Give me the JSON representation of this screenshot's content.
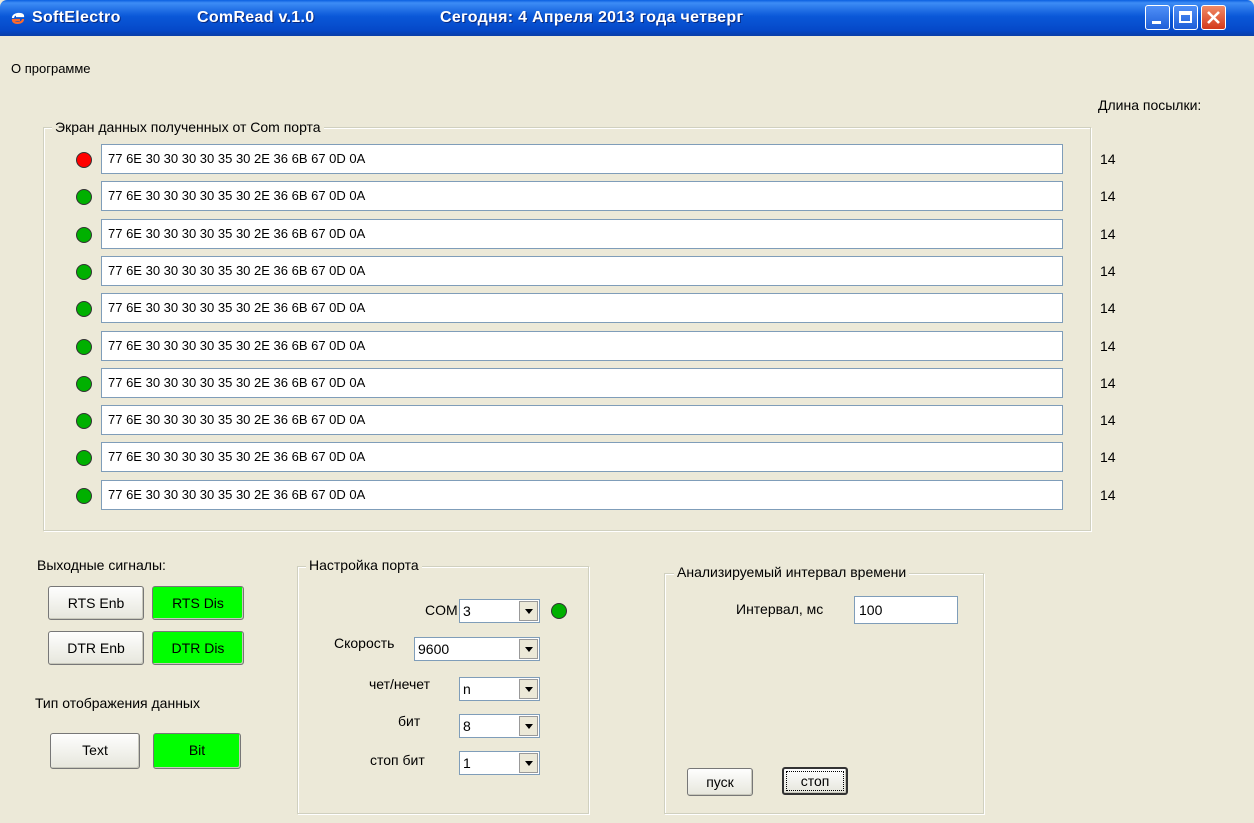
{
  "window": {
    "brand": "SoftElectro",
    "app_name": "ComRead v.1.0",
    "date_text": "Сегодня: 4  Апреля  2013 года  четверг"
  },
  "menu": {
    "about": "О программе"
  },
  "data_screen": {
    "legend": "Экран данных полученных от Com порта",
    "length_header": "Длина посылки:",
    "rows": [
      {
        "status": "red",
        "value": "77 6E 30 30 30 30 35 30 2E 36 6B 67 0D 0A",
        "length": "14"
      },
      {
        "status": "green",
        "value": "77 6E 30 30 30 30 35 30 2E 36 6B 67 0D 0A",
        "length": "14"
      },
      {
        "status": "green",
        "value": "77 6E 30 30 30 30 35 30 2E 36 6B 67 0D 0A",
        "length": "14"
      },
      {
        "status": "green",
        "value": "77 6E 30 30 30 30 35 30 2E 36 6B 67 0D 0A",
        "length": "14"
      },
      {
        "status": "green",
        "value": "77 6E 30 30 30 30 35 30 2E 36 6B 67 0D 0A",
        "length": "14"
      },
      {
        "status": "green",
        "value": "77 6E 30 30 30 30 35 30 2E 36 6B 67 0D 0A",
        "length": "14"
      },
      {
        "status": "green",
        "value": "77 6E 30 30 30 30 35 30 2E 36 6B 67 0D 0A",
        "length": "14"
      },
      {
        "status": "green",
        "value": "77 6E 30 30 30 30 35 30 2E 36 6B 67 0D 0A",
        "length": "14"
      },
      {
        "status": "green",
        "value": "77 6E 30 30 30 30 35 30 2E 36 6B 67 0D 0A",
        "length": "14"
      },
      {
        "status": "green",
        "value": "77 6E 30 30 30 30 35 30 2E 36 6B 67 0D 0A",
        "length": "14"
      }
    ]
  },
  "output_signals": {
    "label": "Выходные сигналы:",
    "rts_enb": "RTS Enb",
    "rts_dis": "RTS Dis",
    "dtr_enb": "DTR Enb",
    "dtr_dis": "DTR Dis",
    "display_type_label": "Тип отображения данных",
    "text_button": "Text",
    "bit_button": "Bit"
  },
  "port_settings": {
    "legend": "Настройка порта",
    "com_label": "COM",
    "com_value": "3",
    "speed_label": "Скорость",
    "speed_value": "9600",
    "parity_label": "чет/нечет",
    "parity_value": "n",
    "bits_label": "бит",
    "bits_value": "8",
    "stop_bits_label": "стоп бит",
    "stop_bits_value": "1"
  },
  "interval": {
    "legend": "Анализируемый интервал времени",
    "label": "Интервал, мс",
    "value": "100",
    "start_button": "пуск",
    "stop_button": "стоп"
  },
  "colors": {
    "active_green": "#00ff00",
    "led_green": "#00b000",
    "led_red": "#ff0000",
    "titlebar_blue": "#0a58d8",
    "window_bg": "#ece9d8"
  }
}
